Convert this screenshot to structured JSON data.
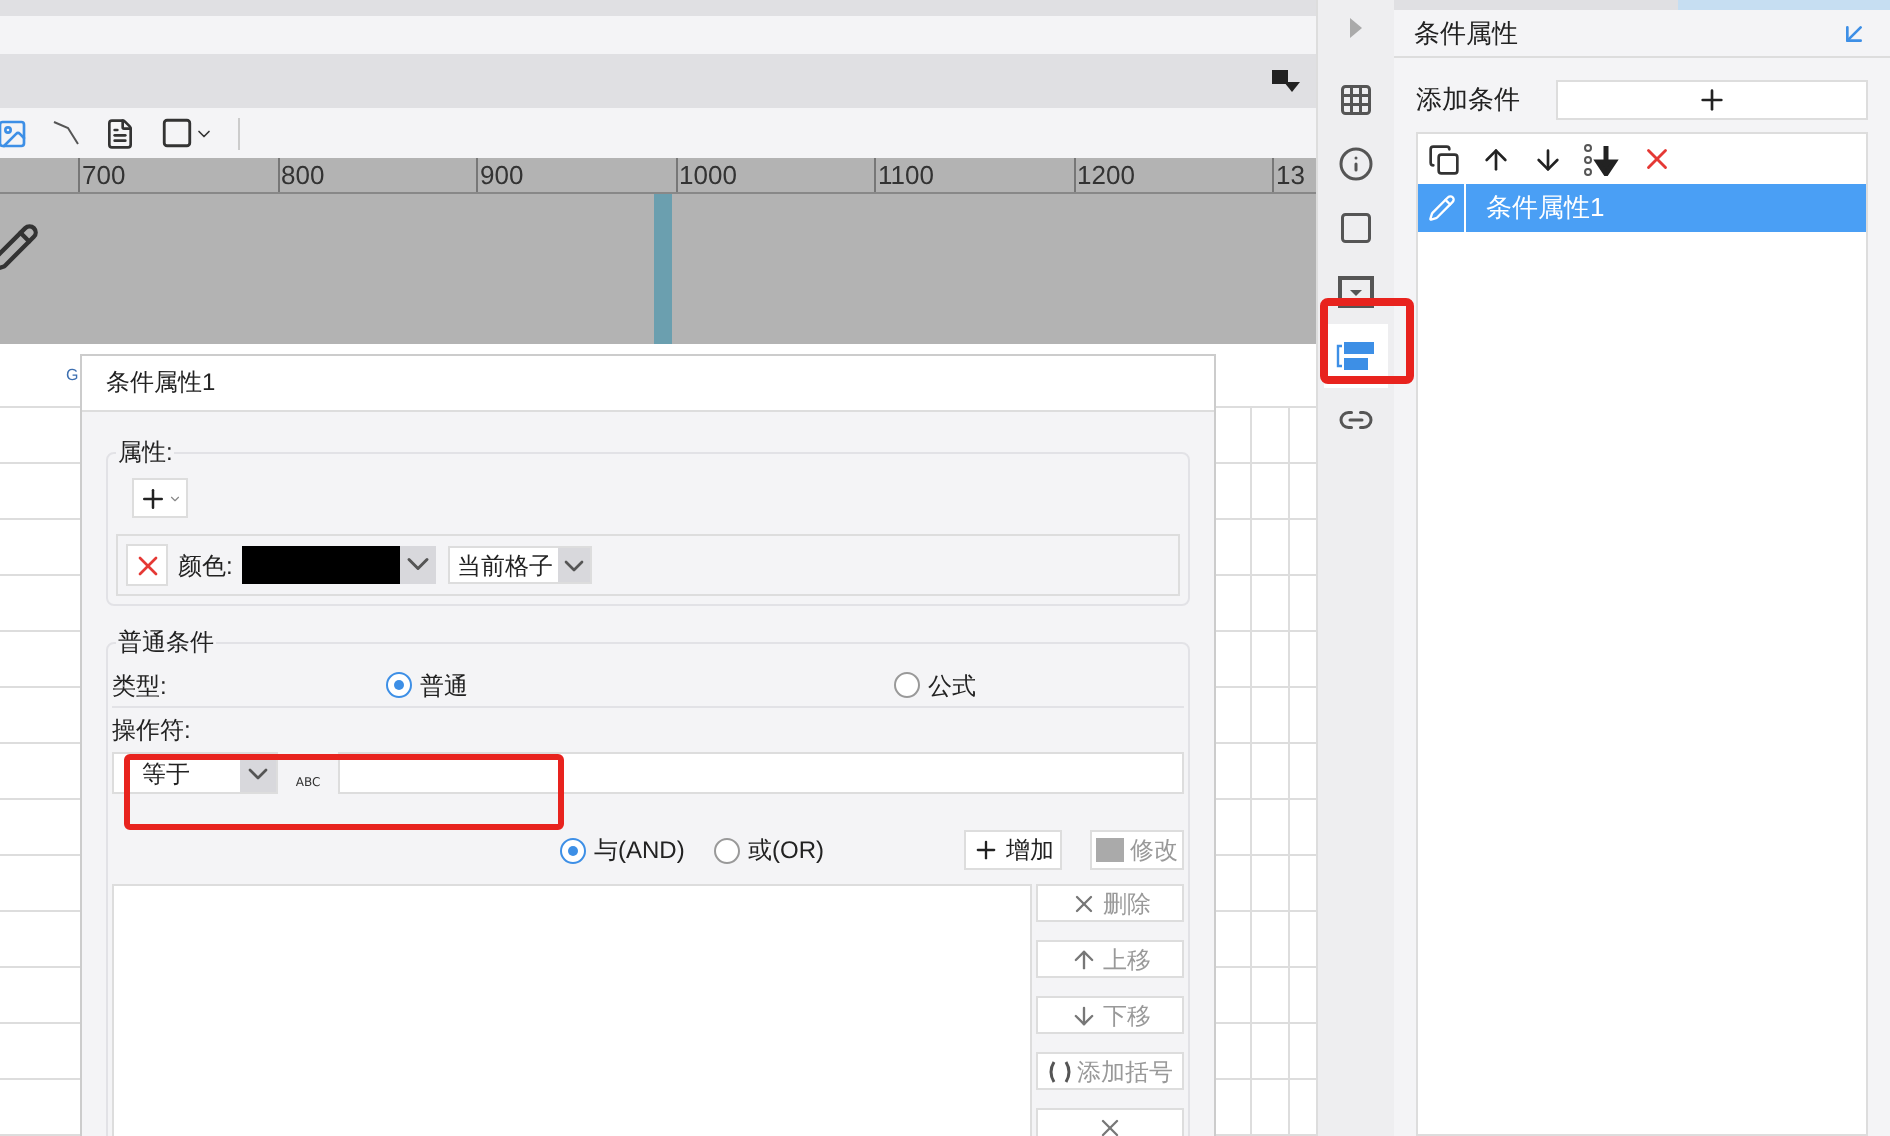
{
  "ruler": {
    "labels": [
      "700",
      "800",
      "900",
      "1000",
      "1100",
      "1200",
      "13"
    ]
  },
  "sheet": {
    "column_header": "G"
  },
  "dialog": {
    "title": "条件属性1",
    "attributes": {
      "legend": "属性:",
      "rows": [
        {
          "label": "颜色:",
          "color": "#000000",
          "scope": "当前格子"
        }
      ]
    },
    "condition": {
      "legend": "普通条件",
      "type_label": "类型:",
      "types": [
        {
          "label": "普通",
          "selected": true
        },
        {
          "label": "公式",
          "selected": false
        }
      ],
      "operator_label": "操作符:",
      "operator": "等于",
      "value_type_icon_text": "ABC"
    },
    "joins": [
      {
        "label": "与(AND)",
        "selected": true
      },
      {
        "label": "或(OR)",
        "selected": false
      }
    ],
    "add_button": {
      "label": "增加",
      "disabled": false
    },
    "modify_button": {
      "label": "修改",
      "disabled": true
    },
    "side_buttons": [
      {
        "kind": "x",
        "label": "删除",
        "disabled": true
      },
      {
        "kind": "up",
        "label": "上移",
        "disabled": true
      },
      {
        "kind": "down",
        "label": "下移",
        "disabled": true
      },
      {
        "kind": "paren",
        "label": "添加括号",
        "disabled": true
      },
      {
        "kind": "x",
        "disabled": true
      }
    ]
  },
  "side_tabs": [
    {
      "kind": "grid",
      "selected": false
    },
    {
      "kind": "info",
      "selected": false
    },
    {
      "kind": "frame",
      "selected": false
    },
    {
      "kind": "dropdown",
      "selected": false
    },
    {
      "kind": "condition",
      "selected": true
    },
    {
      "kind": "link",
      "selected": false
    }
  ],
  "side_panel": {
    "title": "条件属性",
    "add_label": "添加条件",
    "conditions": [
      {
        "label": "条件属性1",
        "selected": true
      }
    ]
  }
}
